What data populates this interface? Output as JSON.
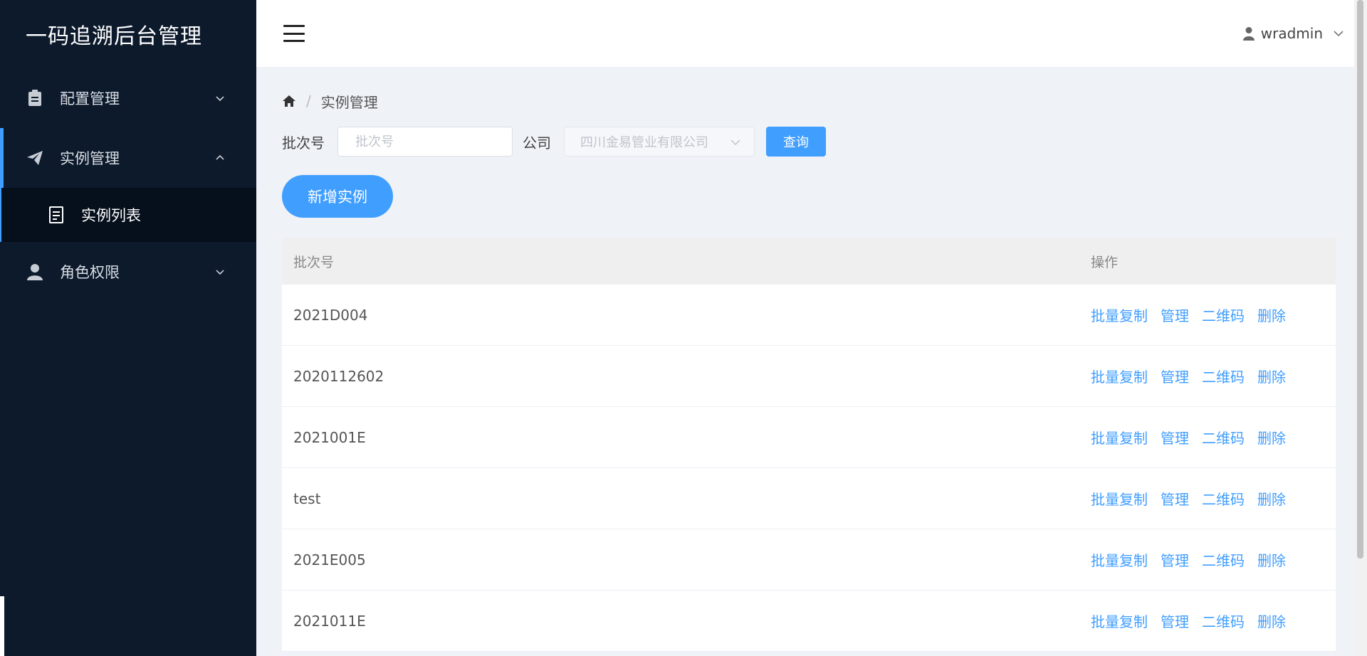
{
  "sidebar": {
    "brand": "一码追溯后台管理",
    "menus": [
      {
        "label": "配置管理"
      },
      {
        "label": "实例管理"
      },
      {
        "label": "实例列表"
      },
      {
        "label": "角色权限"
      }
    ]
  },
  "header": {
    "username": "wradmin"
  },
  "breadcrumb": {
    "current": "实例管理",
    "separator": "/"
  },
  "filter": {
    "batch_label": "批次号",
    "batch_placeholder": "批次号",
    "company_label": "公司",
    "company_selected": "四川金易管业有限公司",
    "query_button": "查询"
  },
  "add_button": "新增实例",
  "table": {
    "columns": [
      "批次号",
      "操作"
    ],
    "actions": [
      "批量复制",
      "管理",
      "二维码",
      "删除"
    ],
    "rows": [
      {
        "batch": "2021D004"
      },
      {
        "batch": "2020112602"
      },
      {
        "batch": "2021001E"
      },
      {
        "batch": "test"
      },
      {
        "batch": "2021E005"
      },
      {
        "batch": "2021011E"
      }
    ]
  },
  "colors": {
    "sidebar_bg": "#0c1a2c",
    "accent": "#409eff",
    "content_bg": "#eff2f7"
  }
}
